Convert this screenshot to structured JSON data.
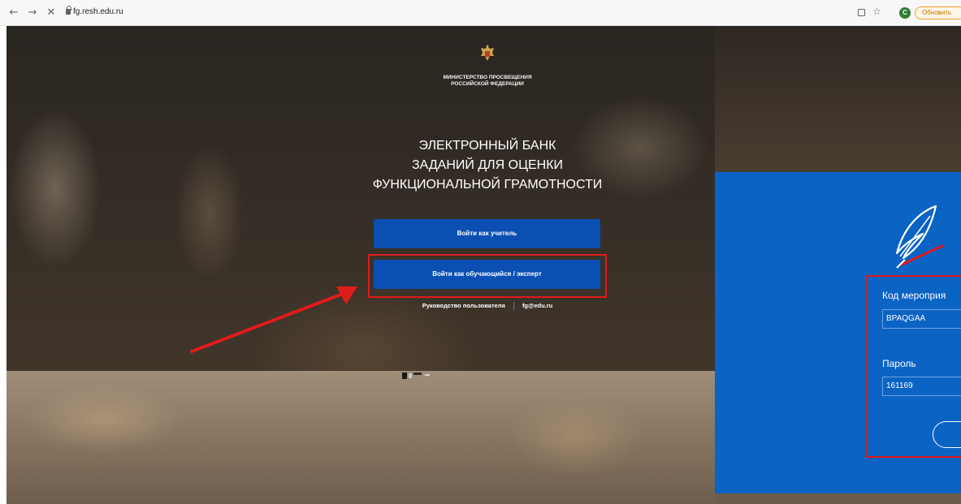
{
  "browser": {
    "url": "fg.resh.edu.ru",
    "back_glyph": "←",
    "forward_glyph": "→",
    "close_glyph": "✕",
    "star_glyph": "☆",
    "profile_initial": "C",
    "update_label": "Обновить"
  },
  "header": {
    "ministry_line1": "МИНИСТЕРСТВО ПРОСВЕЩЕНИЯ",
    "ministry_line2": "РОССИЙСКОЙ ФЕДЕРАЦИИ",
    "title_line1": "ЭЛЕКТРОННЫЙ БАНК",
    "title_line2": "ЗАДАНИЙ ДЛЯ ОЦЕНКИ",
    "title_line3": "ФУНКЦИОНАЛЬНОЙ ГРАМОТНОСТИ"
  },
  "actions": {
    "teacher_login": "Войти как учитель",
    "student_login": "Войти как обучающийся / эксперт"
  },
  "footer": {
    "guide_link": "Руководство пользователя",
    "email_link": "fg@edu.ru"
  },
  "login_form": {
    "code_label": "Код мероприя",
    "code_value": "BPAQGAA",
    "password_label": "Пароль",
    "password_value": "161169"
  },
  "colors": {
    "primary_button": "#0b4fb3",
    "panel_blue": "#0b63c4",
    "highlight_red": "#e01b1b"
  }
}
